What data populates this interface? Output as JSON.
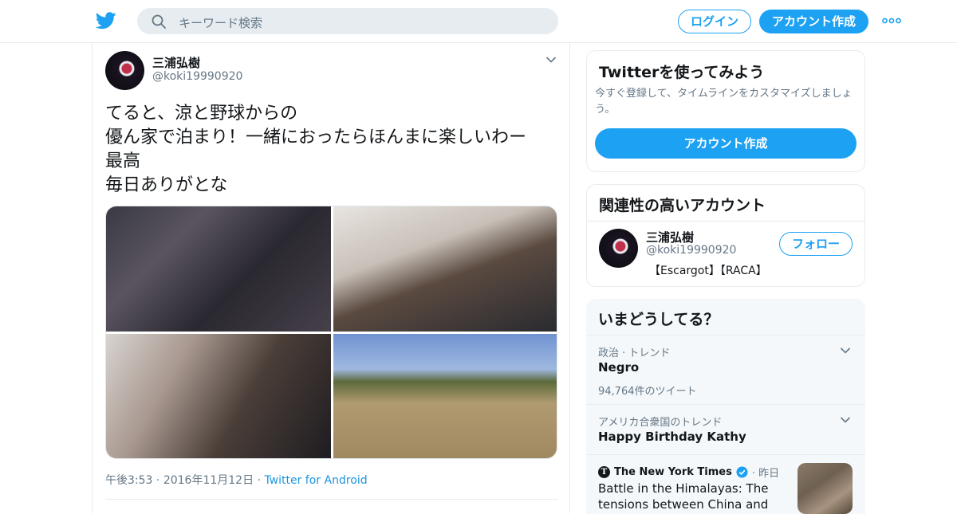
{
  "header": {
    "search_placeholder": "キーワード検索",
    "login_label": "ログイン",
    "signup_label": "アカウント作成"
  },
  "tweet": {
    "name": "三浦弘樹",
    "handle": "@koki19990920",
    "lines": [
      "てると、涼と野球からの",
      "優ん家で泊まり！一緒におったらほんまに楽しいわー",
      "最高",
      "毎日ありがとな"
    ],
    "time": "午後3:53",
    "date": "2016年11月12日",
    "client": "Twitter for Android",
    "sep": "·"
  },
  "sidebar": {
    "try_card": {
      "title": "Twitterを使ってみよう",
      "description": "今すぐ登録して、タイムラインをカスタマイズしましょう。",
      "button": "アカウント作成"
    },
    "related_card": {
      "title": "関連性の高いアカウント",
      "name": "三浦弘樹",
      "handle": "@koki19990920",
      "bio": "【Escargot】【RACA】",
      "follow_label": "フォロー"
    },
    "trends_card": {
      "title": "いまどうしてる？",
      "trends": [
        {
          "context": "政治 · トレンド",
          "name": "Negro",
          "count": "94,764件のツイート"
        },
        {
          "context": "アメリカ合衆国のトレンド",
          "name": "Happy Birthday Kathy",
          "count": ""
        }
      ],
      "news": {
        "source": "The New York Times",
        "time": "· 昨日",
        "title": "Battle in the Himalayas: The tensions between China and India"
      }
    }
  },
  "colors": {
    "accent": "#1da1f2",
    "text": "#14171a",
    "muted": "#657786",
    "border": "#e6ecf0",
    "trend_bg": "#f5f8fa"
  }
}
